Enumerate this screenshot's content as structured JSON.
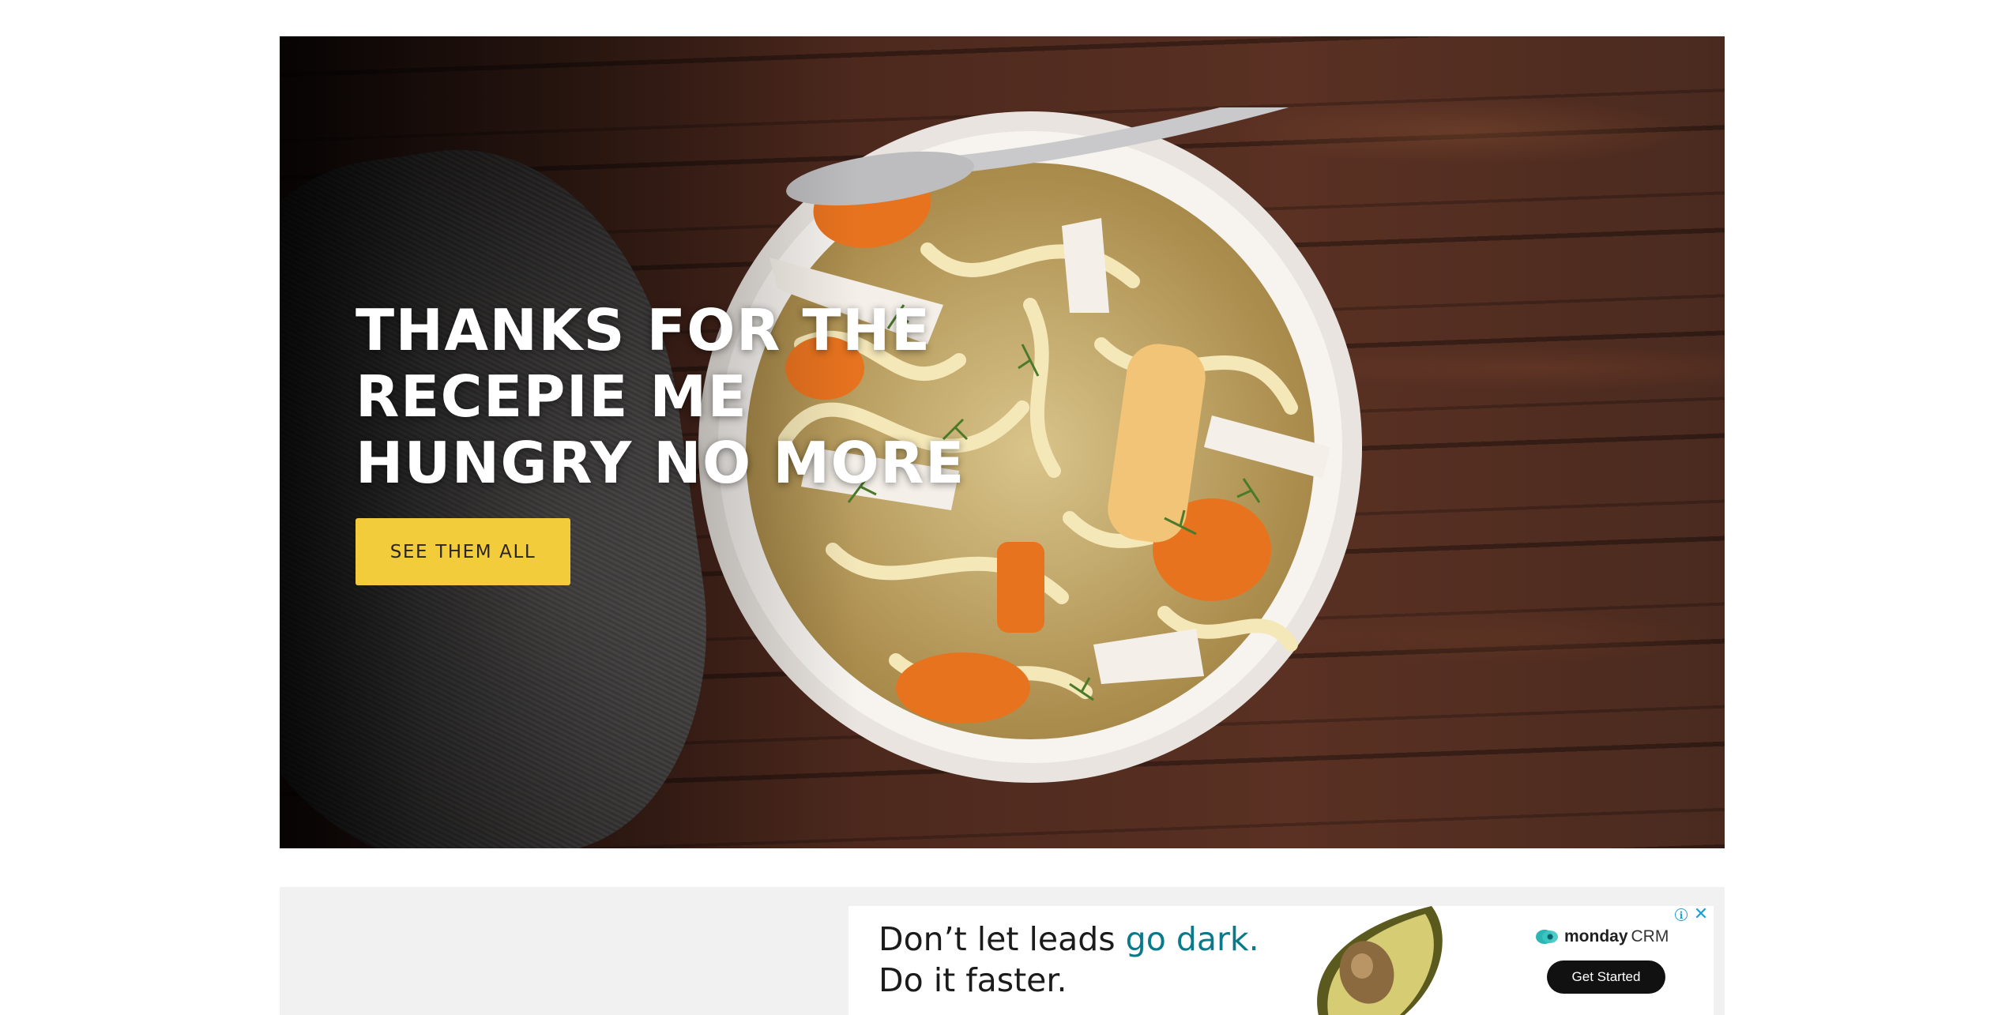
{
  "hero": {
    "title": "THANKS FOR THE RECEPIE ME HUNGRY NO MORE",
    "button_label": "SEE THEM ALL"
  },
  "ad": {
    "headline_prefix": "Don’t let leads ",
    "headline_accent": "go dark.",
    "subline": "Do it faster.",
    "brand": "monday",
    "brand_suffix": "CRM",
    "cta_label": "Get Started",
    "info_glyph": "i",
    "close_glyph": "✕"
  },
  "colors": {
    "button_yellow": "#f2cc3b",
    "ad_accent": "#0a7a8a",
    "ad_controls": "#1aa0d8"
  },
  "icons": [
    "info-icon",
    "close-icon",
    "monday-logo-icon"
  ]
}
